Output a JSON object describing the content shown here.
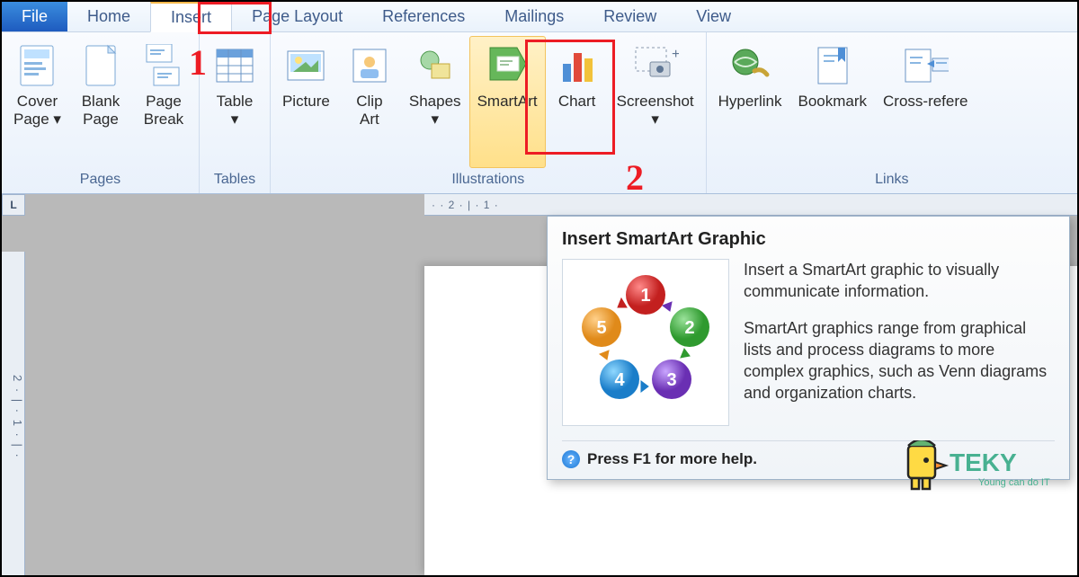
{
  "tabs": {
    "file": "File",
    "home": "Home",
    "insert": "Insert",
    "page_layout": "Page Layout",
    "references": "References",
    "mailings": "Mailings",
    "review": "Review",
    "view": "View"
  },
  "annotations": {
    "one": "1",
    "two": "2"
  },
  "ribbon": {
    "groups": {
      "pages": {
        "label": "Pages",
        "cover_page": "Cover\nPage ▾",
        "blank_page": "Blank\nPage",
        "page_break": "Page\nBreak"
      },
      "tables": {
        "label": "Tables",
        "table": "Table\n▾"
      },
      "illustrations": {
        "label": "Illustrations",
        "picture": "Picture",
        "clip_art": "Clip\nArt",
        "shapes": "Shapes\n▾",
        "smartart": "SmartArt",
        "chart": "Chart",
        "screenshot": "Screenshot\n▾"
      },
      "links": {
        "label": "Links",
        "hyperlink": "Hyperlink",
        "bookmark": "Bookmark",
        "cross_reference": "Cross-refere"
      }
    }
  },
  "ruler": {
    "corner": "L",
    "top_marks": "· · 2 · | · 1 ·",
    "left_marks": "2 · | · 1 · | ·"
  },
  "tooltip": {
    "title": "Insert SmartArt Graphic",
    "para1": "Insert a SmartArt graphic to visually communicate information.",
    "para2": "SmartArt graphics range from graphical lists and process diagrams to more complex graphics, such as Venn diagrams and organization charts.",
    "footer": "Press F1 for more help.",
    "cycle": {
      "n1": "1",
      "n2": "2",
      "n3": "3",
      "n4": "4",
      "n5": "5"
    }
  },
  "watermark": {
    "brand": "TEKY",
    "tagline": "Young can do IT"
  }
}
